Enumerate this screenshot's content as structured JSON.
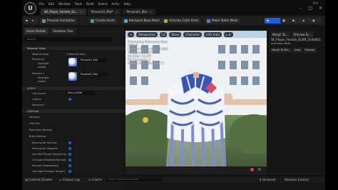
{
  "app": {
    "logo": "U",
    "project": "PixI",
    "menu": [
      "File",
      "Edit",
      "Window",
      "Tools",
      "Build",
      "Select",
      "Actor",
      "Help"
    ]
  },
  "doc_tabs": [
    {
      "label": "SK_Player_Female_Ou...",
      "active": true
    },
    {
      "label": "Personal1_Mat*",
      "active": false
    },
    {
      "label": "Personal1_Mat",
      "active": false
    }
  ],
  "toolbar": {
    "preview_animation": "Preview Animation",
    "create_asset": "Create Asset",
    "reimport": "Reimport Base Mesh",
    "activate_cloth": "Activate Cloth Paint",
    "make_static": "Make Static Mesh"
  },
  "left_panel": {
    "tabs": [
      "Asset Details",
      "Skeleton Tree"
    ],
    "search_placeholder": "Search",
    "sections": {
      "material_slots": "Material Slots",
      "lod0": "LOD 0",
      "lod_info": "LOD Info",
      "sections": "Sections",
      "reduction": "Reduction Settings",
      "build": "Build Settings"
    },
    "rows": {
      "material_slots": "Material Slots",
      "slot_count": "3 Material Slots",
      "element0": "Element 0",
      "element1": "Element 1",
      "highlight": "Highlight",
      "isolate": "Isolate",
      "mat_label": "Personal1_Mat",
      "lod_import": "LOD Import",
      "auto_lod": "Auto (LOD0)",
      "custom": "Custom",
      "advanced": "Advanced",
      "recompute_normals": "Recompute Normals",
      "recompute_tangents": "Recompute Tangents",
      "use_mikkt": "Use MikkTSpace Tangent Sp...",
      "compute_weighted": "Compute Weighted Normals",
      "remove_degen": "Remove Degenerates",
      "high_precision": "Use High Precision Tangent"
    }
  },
  "viewport": {
    "buttons": [
      "Perspective",
      "Lit",
      "Show",
      "Character",
      "LOD Auto"
    ],
    "stats": [
      "Previewing Reference Pose",
      "LOD: 0",
      "Current Screen Size: 1.000",
      "Triangles: 19,4??",
      "Vertices: 14,4??",
      "UV Channels: 1",
      "Approx Size: 84x66x171"
    ]
  },
  "right_panel": {
    "tabs": [
      "Morph Ta...",
      "Preview Sc..."
    ],
    "mesh_name": "SK_Player_Female_Outfit_Cloth001",
    "sub": "Animation Mode",
    "buttons": [
      "Morph To Ma...",
      "Auto",
      "Preview"
    ]
  },
  "statusbar": {
    "content_drawer": "Content Drawer",
    "output_log": "Output Log",
    "cmd": "Cmd",
    "cmd_placeholder": "Enter Console Command",
    "unsaved": "4 Unsaved",
    "revision": "Revision Control"
  },
  "colors": {
    "accent": "#1c5fd6",
    "bg": "#151515"
  }
}
